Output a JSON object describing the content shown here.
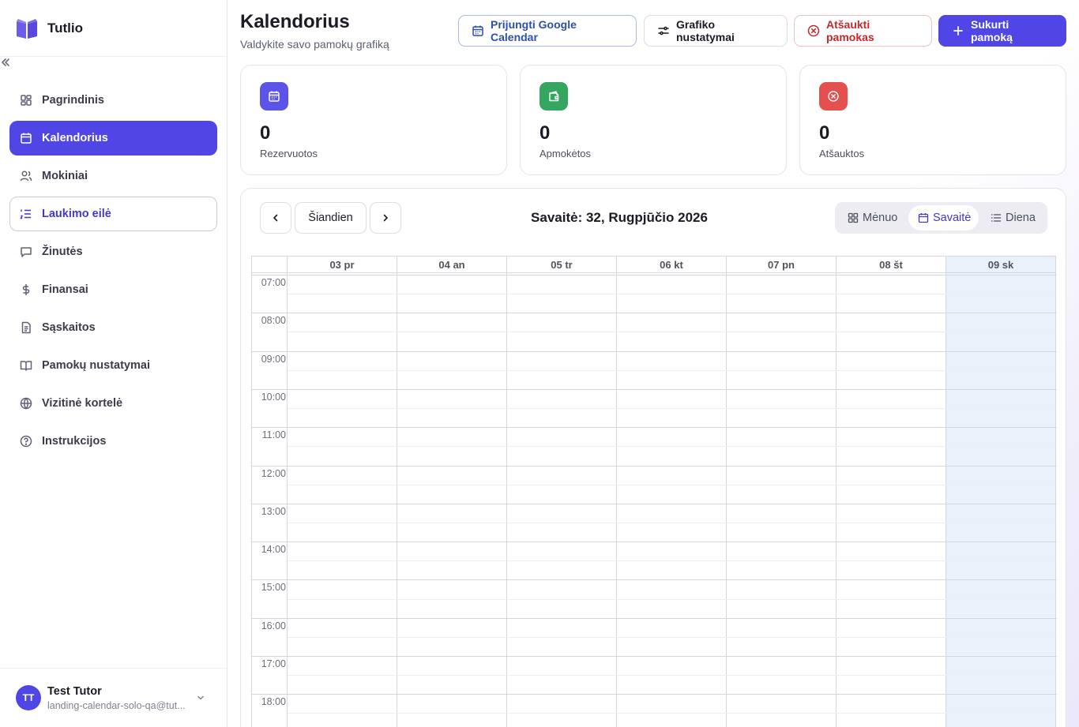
{
  "brand": {
    "name": "Tutlio",
    "logo_icon": "book-logo-icon",
    "accent": "#4f46e5"
  },
  "sidebar": {
    "items": [
      {
        "label": "Pagrindinis",
        "icon": "dashboard-icon",
        "state": "normal"
      },
      {
        "label": "Kalendorius",
        "icon": "calendar-icon",
        "state": "active"
      },
      {
        "label": "Mokiniai",
        "icon": "users-icon",
        "state": "normal"
      },
      {
        "label": "Laukimo eilė",
        "icon": "list-ordered-icon",
        "state": "outlined"
      },
      {
        "label": "Žinutės",
        "icon": "message-icon",
        "state": "normal"
      },
      {
        "label": "Finansai",
        "icon": "dollar-icon",
        "state": "normal"
      },
      {
        "label": "Sąskaitos",
        "icon": "document-icon",
        "state": "normal"
      },
      {
        "label": "Pamokų nustatymai",
        "icon": "book-open-icon",
        "state": "normal"
      },
      {
        "label": "Vizitinė kortelė",
        "icon": "globe-icon",
        "state": "normal"
      },
      {
        "label": "Instrukcijos",
        "icon": "help-circle-icon",
        "state": "normal"
      }
    ]
  },
  "user": {
    "initials": "TT",
    "name": "Test Tutor",
    "email": "landing-calendar-solo-qa@tut..."
  },
  "header": {
    "title": "Kalendorius",
    "subtitle": "Valdykite savo pamokų grafiką",
    "google_label": "Prijungti Google Calendar",
    "settings_label": "Grafiko nustatymai",
    "cancel_label": "Atšaukti pamokas",
    "create_label": "Sukurti pamoką"
  },
  "stats": [
    {
      "value": "0",
      "label": "Rezervuotos",
      "color": "#5b54e8",
      "icon": "calendar-icon"
    },
    {
      "value": "0",
      "label": "Apmokėtos",
      "color": "#34a65f",
      "icon": "wallet-icon"
    },
    {
      "value": "0",
      "label": "Atšauktos",
      "color": "#e4504f",
      "icon": "x-circle-icon"
    }
  ],
  "calendar": {
    "today_label": "Šiandien",
    "week_title": "Savaitė: 32, Rugpjūčio 2026",
    "views": [
      {
        "label": "Mėnuo",
        "icon": "grid-icon",
        "active": false
      },
      {
        "label": "Savaitė",
        "icon": "calendar-icon",
        "active": true
      },
      {
        "label": "Diena",
        "icon": "list-icon",
        "active": false
      }
    ],
    "days": [
      "03 pr",
      "04 an",
      "05 tr",
      "06 kt",
      "07 pn",
      "08 št",
      "09 sk"
    ],
    "today_day": "09 sk",
    "today_color": "#e9f2fb",
    "hours": [
      "07:00",
      "08:00",
      "09:00",
      "10:00",
      "11:00",
      "12:00",
      "13:00",
      "14:00",
      "15:00",
      "16:00",
      "17:00",
      "18:00"
    ]
  }
}
